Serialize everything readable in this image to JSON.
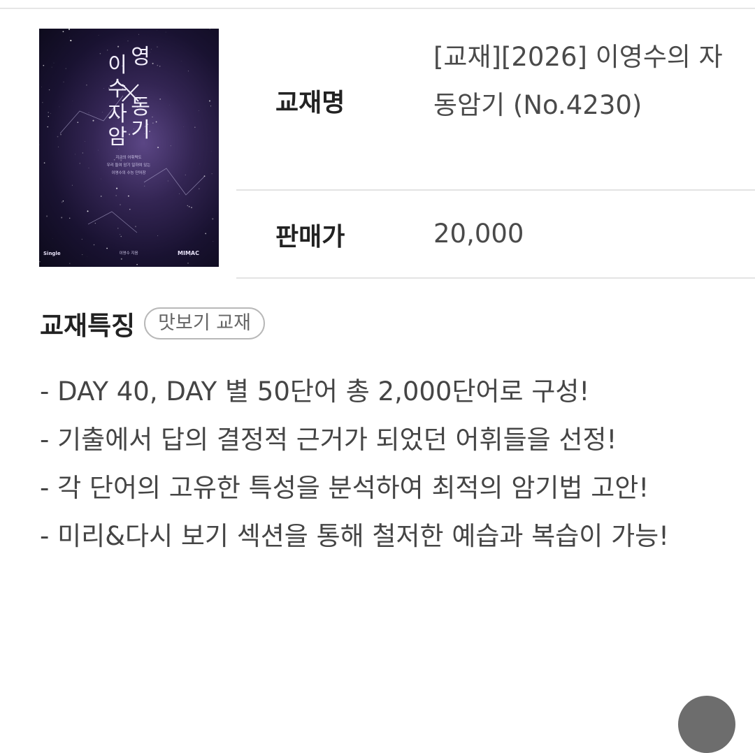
{
  "product": {
    "cover": {
      "title_glyphs": [
        "이",
        "영",
        "수",
        "자",
        "동",
        "암",
        "기"
      ],
      "tagline_lines": [
        "지금의 어휘력도",
        "우리 들여 암기 일하여 있는",
        "이영수의 수능 단어장"
      ],
      "author": "이영수 지음",
      "publisher_mark": "MIMAC",
      "series_mark": "Single"
    },
    "title_label": "교재명",
    "title_value": "[교재][2026] 이영수의 자동암기 (No.4230)",
    "price_label": "판매가",
    "price_value": "20,000"
  },
  "features": {
    "heading": "교재특징",
    "badge": "맛보기 교재",
    "items": [
      "- DAY 40, DAY 별 50단어 총 2,000단어로 구성!",
      "- 기출에서 답의 결정적 근거가 되었던 어휘들을 선정!",
      "- 각 단어의 고유한 특성을 분석하여 최적의 암기법 고안!",
      "- 미리&다시 보기 섹션을 통해 철저한 예습과 복습이 가능!"
    ]
  },
  "colors": {
    "cover_dark": "#0c0a1a",
    "cover_mid": "#332553",
    "divider": "#e3e3e3",
    "text_value": "#4a4a4a"
  }
}
